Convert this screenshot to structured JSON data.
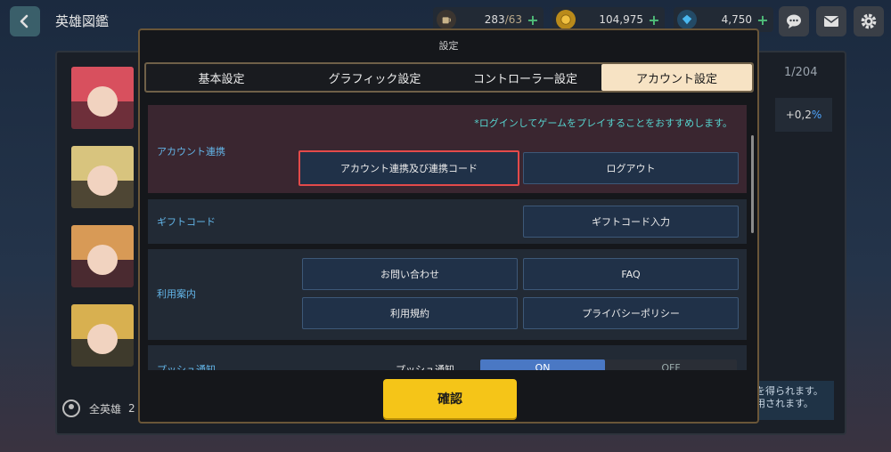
{
  "header": {
    "title": "英雄図鑑"
  },
  "resources": [
    {
      "icon": "stamina-cup-icon",
      "value": "283",
      "max": "/63"
    },
    {
      "icon": "gold-coin-icon",
      "value": "104,975"
    },
    {
      "icon": "gem-icon",
      "value": "4,750"
    }
  ],
  "background_list": {
    "count": "1/204",
    "bonus_prefix": "+0,2",
    "bonus_unit": "%",
    "footer_label": "全英雄",
    "footer_value": "2",
    "note_line1": "を得られます。",
    "note_line2": "用されます。"
  },
  "modal": {
    "title": "設定",
    "tabs": [
      {
        "label": "基本設定"
      },
      {
        "label": "グラフィック設定"
      },
      {
        "label": "コントローラー設定"
      },
      {
        "label": "アカウント設定"
      }
    ],
    "account": {
      "label": "アカウント連携",
      "recommend": "*ログインしてゲームをプレイすることをおすすめします。",
      "link_button": "アカウント連携及び連携コード",
      "logout_button": "ログアウト"
    },
    "gift": {
      "label": "ギフトコード",
      "button": "ギフトコード入力"
    },
    "guide": {
      "label": "利用案内",
      "buttons": [
        "お問い合わせ",
        "FAQ",
        "利用規約",
        "プライバシーポリシー"
      ]
    },
    "push": {
      "label": "プッシュ通知",
      "sublabel": "プッシュ通知",
      "on": "ON",
      "off": "OFF"
    },
    "confirm": "確認"
  },
  "colors": {
    "accent_blue": "#63b5e8",
    "recommend_cyan": "#56d4cf",
    "confirm_yellow": "#f5c518",
    "highlight_red": "#e34a4a",
    "active_tab": "#f7e3c4"
  }
}
